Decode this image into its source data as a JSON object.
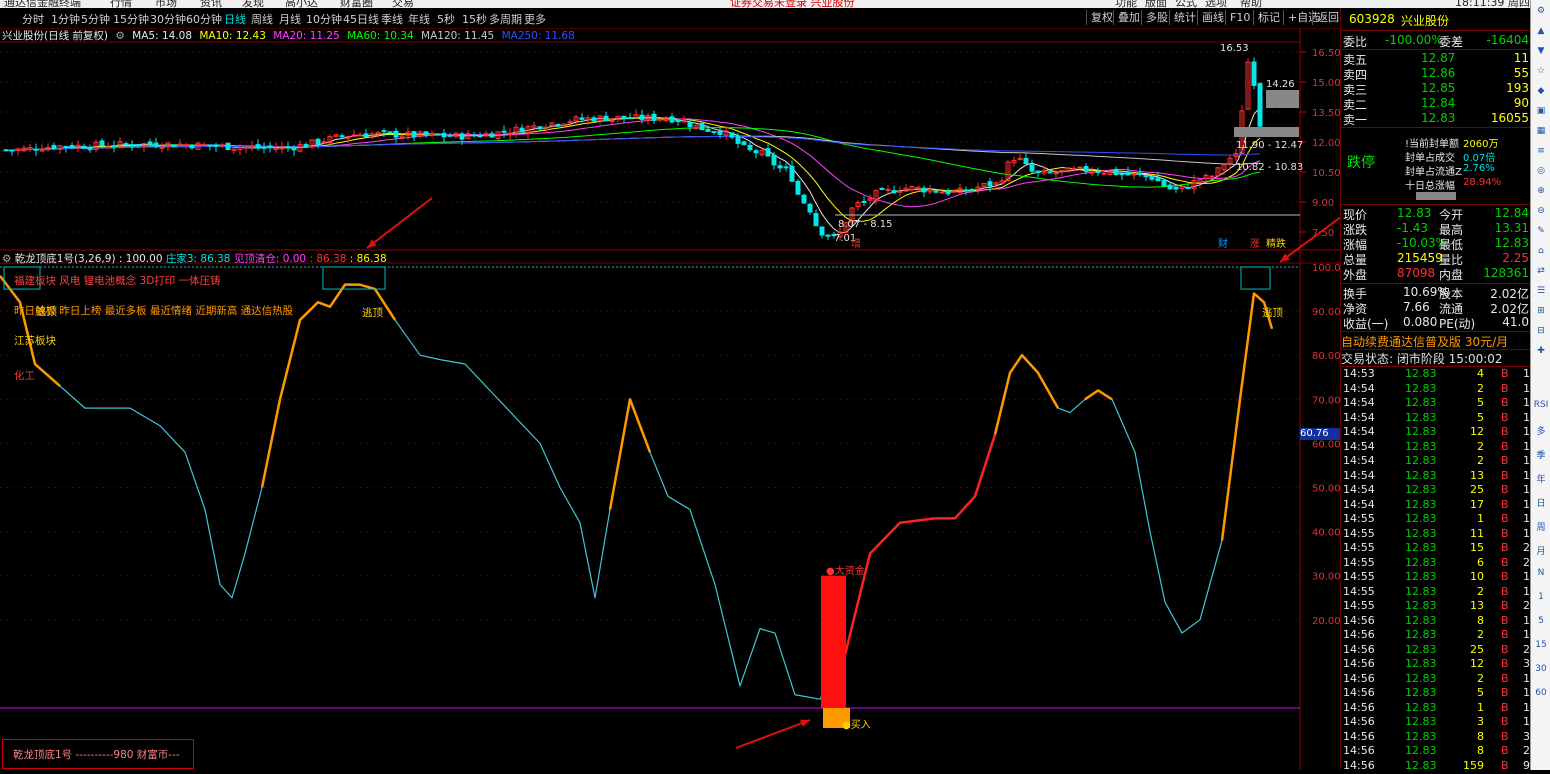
{
  "menu": [
    "通达信金融终端",
    "行情",
    "市场",
    "资讯",
    "发现",
    "高小达",
    "财富圈",
    "交易",
    "功能",
    "版面",
    "公式",
    "选项",
    "帮助",
    "18:11:39 周四"
  ],
  "menu_notice": "证券交易未登录  兴业股份",
  "period_tabs": [
    "分时",
    "1分钟",
    "5分钟",
    "15分钟",
    "30分钟",
    "60分钟",
    "日线",
    "周线",
    "月线",
    "10分钟",
    "45日线",
    "季线",
    "年线",
    "5秒",
    "15秒",
    "多周期",
    "更多"
  ],
  "active_tab": "日线",
  "right_tabs": [
    "复权",
    "叠加",
    "多股",
    "统计",
    "画线",
    "F10",
    "标记",
    "+自选",
    "返回"
  ],
  "title": "兴业股份(日线 前复权)",
  "ma_legend": {
    "ma5": "MA5: 14.08",
    "ma10": "MA10: 12.43",
    "ma20": "MA20: 11.25",
    "ma60": "MA60: 10.34",
    "ma120": "MA120: 11.45",
    "ma250": "MA250: 11.68"
  },
  "colors": {
    "ma5": "#e8e8e8",
    "ma10": "#ffff00",
    "ma20": "#ff40ff",
    "ma60": "#00ff00",
    "ma120": "#c8c8c8",
    "ma250": "#3050ff",
    "up": "#ff3030",
    "down": "#00e8e8",
    "osc": "#40c8d8",
    "osc_hot": "#ff9900",
    "osc_red": "#ff2020"
  },
  "price_axis": [
    "16.50",
    "15.00",
    "13.50",
    "12.00",
    "10.50",
    "9.00",
    "7.50"
  ],
  "price_annotations": {
    "high": "16.53",
    "high_right": "14.26",
    "mid1": "11.90 - 12.47",
    "mid2": "10.82 - 10.83",
    "low_band": "8.07 - 8.15",
    "low": "7.01"
  },
  "event_markers": {
    "zeng": "增",
    "cai": "财",
    "zhang": "涨",
    "jingxuan": "精跌"
  },
  "indicator": {
    "name": "乾龙顶底1号(3,26,9)",
    "value": ": 100.00",
    "zhuangjia": "庄家3: 86.38",
    "jianding": "见顶清仓: 0.00",
    "v1": ": 86.38",
    "v2": ": 86.38"
  },
  "indicator_axis": [
    "100.0",
    "90.00",
    "80.00",
    "70.00",
    "60.00",
    "50.00",
    "40.00",
    "30.00",
    "20.00"
  ],
  "indicator_marker": "60.76",
  "indicator_notes": {
    "line1": "福建板块 风电 锂电池概念 3D打印 一体压铸",
    "line2": "昨日触板 昨日上榜 最近多板 最近情绪 近期新高 通达信热股",
    "line3": "江苏板块",
    "line4": "化工",
    "top1": "逃顶",
    "top2": "逃顶",
    "top3": "逃顶",
    "big_money": "●大资金",
    "buy": "●买入"
  },
  "footer_label": "乾龙顶底1号 ----------980 财富币---",
  "quote": {
    "code": "603928",
    "name": "兴业股份",
    "weibi_label": "委比",
    "weibi": "-100.00%",
    "weicha_label": "委差",
    "weicha": "-16404",
    "asks": [
      {
        "label": "卖五",
        "price": "12.87",
        "vol": "11"
      },
      {
        "label": "卖四",
        "price": "12.86",
        "vol": "55"
      },
      {
        "label": "卖三",
        "price": "12.85",
        "vol": "193"
      },
      {
        "label": "卖二",
        "price": "12.84",
        "vol": "90"
      },
      {
        "label": "卖一",
        "price": "12.83",
        "vol": "16055"
      }
    ],
    "limit_title": "跌停",
    "limit_rows": [
      {
        "label": "!当前封单额",
        "value": "2060万"
      },
      {
        "label": "封单占成交",
        "value": "0.07倍"
      },
      {
        "label": "封单占流通Z",
        "value": "2.76%"
      },
      {
        "label": "十日总涨幅",
        "value": "28.94%"
      }
    ],
    "stats": [
      {
        "l1": "现价",
        "v1": "12.83",
        "l2": "今开",
        "v2": "12.84"
      },
      {
        "l1": "涨跌",
        "v1": "-1.43",
        "l2": "最高",
        "v2": "13.31"
      },
      {
        "l1": "涨幅",
        "v1": "-10.03%",
        "l2": "最低",
        "v2": "12.83"
      },
      {
        "l1": "总量",
        "v1": "215459",
        "l2": "量比",
        "v2": "2.25"
      },
      {
        "l1": "外盘",
        "v1": "87098",
        "l2": "内盘",
        "v2": "128361"
      }
    ],
    "fund": [
      {
        "l1": "换手",
        "v1": "10.69%",
        "l2": "股本",
        "v2": "2.02亿"
      },
      {
        "l1": "净资",
        "v1": "7.66",
        "l2": "流通",
        "v2": "2.02亿"
      },
      {
        "l1": "收益(一)",
        "v1": "0.080",
        "l2": "PE(动)",
        "v2": "41.0"
      }
    ],
    "ad": "自动续费通达信普及版  30元/月",
    "status": "交易状态: 闭市阶段 15:00:02",
    "ticks": [
      [
        "14:53",
        "12.83",
        "4",
        "B",
        "1"
      ],
      [
        "14:54",
        "12.83",
        "2",
        "B",
        "1"
      ],
      [
        "14:54",
        "12.83",
        "5",
        "B",
        "1"
      ],
      [
        "14:54",
        "12.83",
        "5",
        "B",
        "1"
      ],
      [
        "14:54",
        "12.83",
        "12",
        "B",
        "1"
      ],
      [
        "14:54",
        "12.83",
        "2",
        "B",
        "1"
      ],
      [
        "14:54",
        "12.83",
        "2",
        "B",
        "1"
      ],
      [
        "14:54",
        "12.83",
        "13",
        "B",
        "1"
      ],
      [
        "14:54",
        "12.83",
        "25",
        "B",
        "1"
      ],
      [
        "14:54",
        "12.83",
        "17",
        "B",
        "1"
      ],
      [
        "14:55",
        "12.83",
        "1",
        "B",
        "1"
      ],
      [
        "14:55",
        "12.83",
        "11",
        "B",
        "1"
      ],
      [
        "14:55",
        "12.83",
        "15",
        "B",
        "2"
      ],
      [
        "14:55",
        "12.83",
        "6",
        "B",
        "2"
      ],
      [
        "14:55",
        "12.83",
        "10",
        "B",
        "1"
      ],
      [
        "14:55",
        "12.83",
        "2",
        "B",
        "1"
      ],
      [
        "14:55",
        "12.83",
        "13",
        "B",
        "2"
      ],
      [
        "14:56",
        "12.83",
        "8",
        "B",
        "1"
      ],
      [
        "14:56",
        "12.83",
        "2",
        "B",
        "1"
      ],
      [
        "14:56",
        "12.83",
        "25",
        "B",
        "2"
      ],
      [
        "14:56",
        "12.83",
        "12",
        "B",
        "3"
      ],
      [
        "14:56",
        "12.83",
        "2",
        "B",
        "1"
      ],
      [
        "14:56",
        "12.83",
        "5",
        "B",
        "1"
      ],
      [
        "14:56",
        "12.83",
        "1",
        "B",
        "1"
      ],
      [
        "14:56",
        "12.83",
        "3",
        "B",
        "1"
      ],
      [
        "14:56",
        "12.83",
        "8",
        "B",
        "3"
      ],
      [
        "14:56",
        "12.83",
        "8",
        "B",
        "2"
      ],
      [
        "14:56",
        "12.83",
        "159",
        "B",
        "9"
      ]
    ]
  },
  "toolbar_icons": [
    "RSI",
    "多",
    "季",
    "年",
    "日",
    "周",
    "月",
    "N",
    "1",
    "5",
    "15",
    "30",
    "60"
  ]
}
